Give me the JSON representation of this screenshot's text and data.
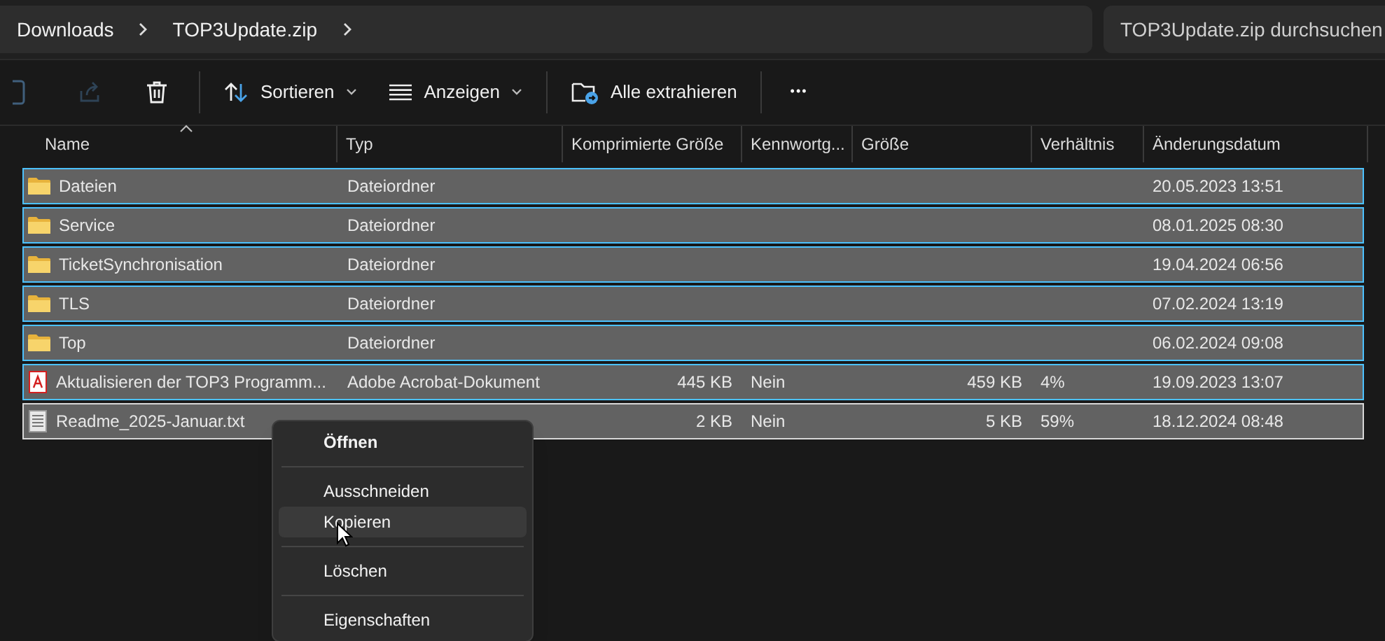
{
  "address_bar": {
    "breadcrumbs": [
      "Downloads",
      "TOP3Update.zip"
    ]
  },
  "search": {
    "placeholder": "TOP3Update.zip durchsuchen"
  },
  "toolbar": [
    {
      "kind": "icon",
      "disabled": true
    },
    {
      "kind": "icon",
      "disabled": true
    },
    {
      "kind": "icon",
      "disabled": false
    },
    {
      "kind": "divider"
    },
    {
      "kind": "menu",
      "label": "Sortieren"
    },
    {
      "kind": "menu",
      "label": "Anzeigen"
    },
    {
      "kind": "divider"
    },
    {
      "kind": "button",
      "label": "Alle extrahieren"
    },
    {
      "kind": "divider"
    },
    {
      "kind": "more",
      "label": "•••"
    }
  ],
  "table": {
    "columns": [
      "Name",
      "Typ",
      "Komprimierte Größe",
      "Kennwortg...",
      "Größe",
      "Verhältnis",
      "Änderungsdatum"
    ],
    "rows": [
      {
        "kind": "folder",
        "name": "Dateien",
        "type": "Dateiordner",
        "date": "20.05.2023 13:51",
        "selected": true,
        "focused": false
      },
      {
        "kind": "folder",
        "name": "Service",
        "type": "Dateiordner",
        "date": "08.01.2025 08:30",
        "selected": true,
        "focused": false
      },
      {
        "kind": "folder",
        "name": "TicketSynchronisation",
        "type": "Dateiordner",
        "date": "19.04.2024 06:56",
        "selected": true,
        "focused": false
      },
      {
        "kind": "folder",
        "name": "TLS",
        "type": "Dateiordner",
        "date": "07.02.2024 13:19",
        "selected": true,
        "focused": false
      },
      {
        "kind": "folder",
        "name": "Top",
        "type": "Dateiordner",
        "date": "06.02.2024 09:08",
        "selected": true,
        "focused": false
      },
      {
        "kind": "pdf",
        "name": "Aktualisieren der TOP3 Programm...",
        "type": "Adobe Acrobat-Dokument",
        "compressed": "445 KB",
        "password": "Nein",
        "size": "459 KB",
        "ratio": "4%",
        "date": "19.09.2023 13:07",
        "selected": true,
        "focused": false
      },
      {
        "kind": "text",
        "name": "Readme_2025-Januar.txt",
        "compressed": "2 KB",
        "password": "Nein",
        "size": "5 KB",
        "ratio": "59%",
        "date": "18.12.2024 08:48",
        "selected": true,
        "focused": true
      }
    ]
  },
  "context_menu": {
    "items": [
      {
        "kind": "item",
        "label": "Öffnen",
        "default": true,
        "hovered": false
      },
      {
        "kind": "separator"
      },
      {
        "kind": "item",
        "label": "Ausschneiden",
        "default": false,
        "hovered": false
      },
      {
        "kind": "item",
        "label": "Kopieren",
        "default": false,
        "hovered": true
      },
      {
        "kind": "separator"
      },
      {
        "kind": "item",
        "label": "Löschen",
        "default": false,
        "hovered": false
      },
      {
        "kind": "separator"
      },
      {
        "kind": "item",
        "label": "Eigenschaften",
        "default": false,
        "hovered": false
      }
    ]
  }
}
